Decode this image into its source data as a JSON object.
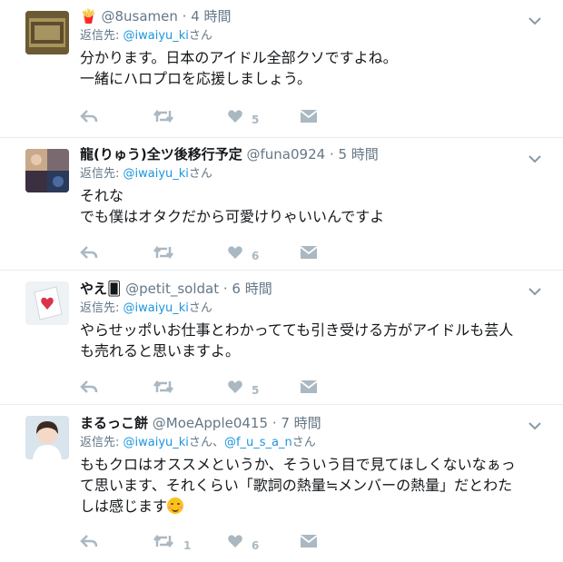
{
  "colors": {
    "link": "#1b95e0",
    "muted": "#657786",
    "icon": "#aab8c2",
    "divider": "#e6ecf0"
  },
  "tweets": [
    {
      "name": "🍟",
      "handle": "@8usamen",
      "time": "· 4 時間",
      "reply_prefix": "返信先: ",
      "reply_to": "@iwaiyu_ki",
      "reply_suffix": "さん",
      "lines": [
        "分かります。日本のアイドル全部クソですよね。",
        "一緒にハロプロを応援しましょう。"
      ],
      "retweets": "",
      "likes": "5"
    },
    {
      "name": "龍(りゅう)全ツ後移行予定",
      "handle": "@funa0924",
      "time": "· 5 時間",
      "reply_prefix": "返信先: ",
      "reply_to": "@iwaiyu_ki",
      "reply_suffix": "さん",
      "lines": [
        "それな",
        "でも僕はオタクだから可愛けりゃいいんですよ"
      ],
      "retweets": "",
      "likes": "6"
    },
    {
      "name": "やえ🂠",
      "handle": "@petit_soldat",
      "time": "· 6 時間",
      "reply_prefix": "返信先: ",
      "reply_to": "@iwaiyu_ki",
      "reply_suffix": "さん",
      "lines": [
        "やらせッポいお仕事とわかってても引き受ける方がアイドルも芸人",
        "も売れると思いますよ。"
      ],
      "retweets": "",
      "likes": "5"
    },
    {
      "name": "まるっこ餅",
      "handle": "@MoeApple0415",
      "time": "· 7 時間",
      "reply_prefix": "返信先: ",
      "reply_to": "@iwaiyu_ki",
      "reply_mid": "さん、",
      "reply_to2": "@f_u_s_a_n",
      "reply_suffix": "さん",
      "lines": [
        "ももクロはオススメというか、そういう目で見てほしくないなぁっ",
        "て思います、それくらい「歌詞の熱量≒メンバーの熱量」だとわた",
        "しは感じます"
      ],
      "retweets": "1",
      "likes": "6"
    }
  ]
}
